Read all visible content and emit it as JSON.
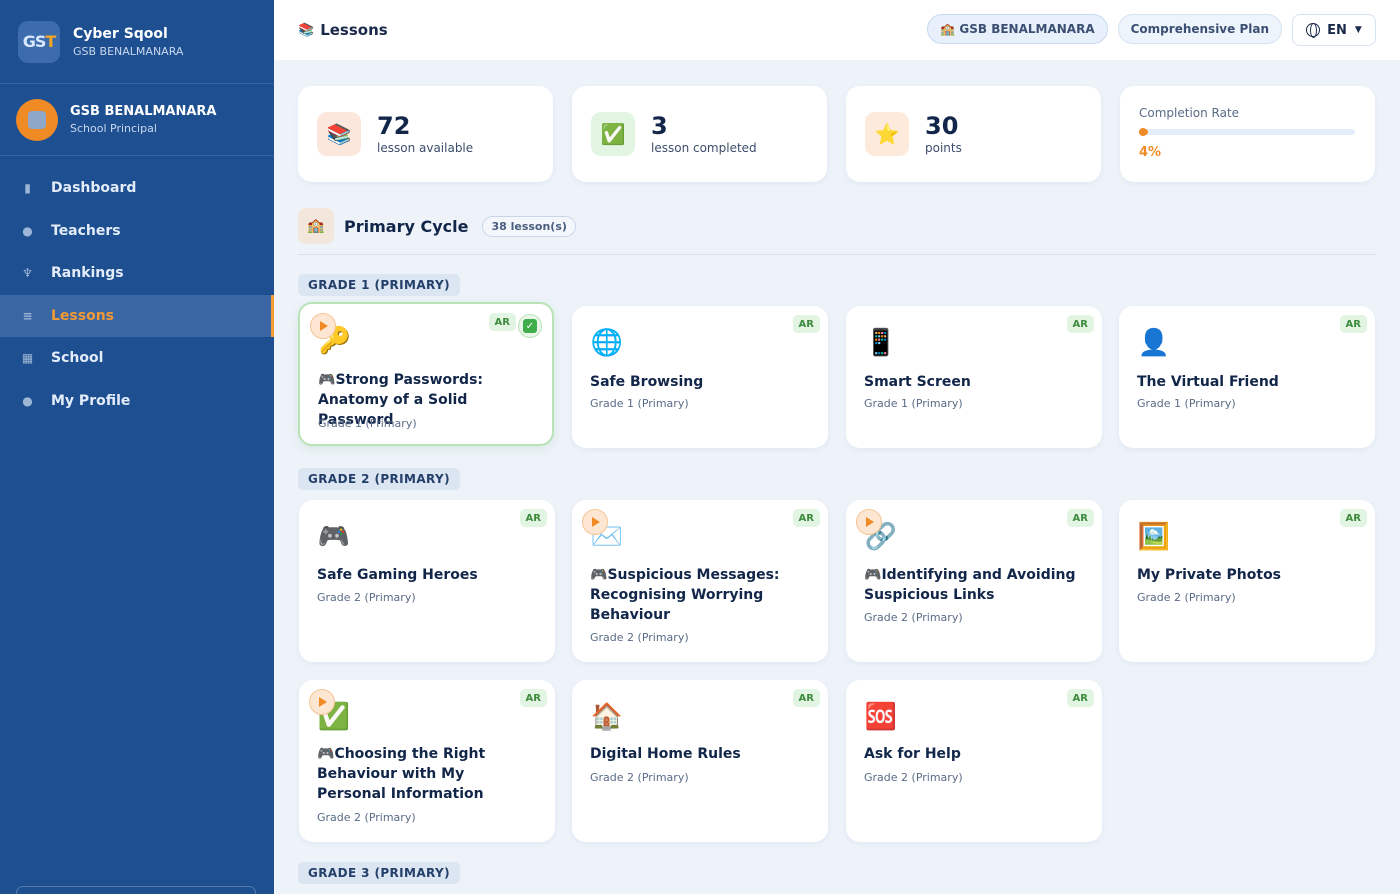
{
  "brand": {
    "logo_text": "GS",
    "logo_accent": "T",
    "title": "Cyber Sqool",
    "subtitle": "GSB BENALMANARA"
  },
  "user": {
    "name": "GSB BENALMANARA",
    "role": "School Principal"
  },
  "nav": [
    {
      "label": "Dashboard",
      "icon": "chart-icon",
      "glyph": "▮"
    },
    {
      "label": "Teachers",
      "icon": "teacher-icon",
      "glyph": "●"
    },
    {
      "label": "Rankings",
      "icon": "trophy-icon",
      "glyph": "♆"
    },
    {
      "label": "Lessons",
      "icon": "books-icon",
      "glyph": "≡",
      "active": true
    },
    {
      "label": "School",
      "icon": "school-icon",
      "glyph": "▦"
    },
    {
      "label": "My Profile",
      "icon": "user-icon",
      "glyph": "●"
    }
  ],
  "header": {
    "title": "Lessons",
    "school_pill": "🏫 GSB BENALMANARA",
    "plan_pill": "Comprehensive Plan",
    "lang": "EN"
  },
  "stats": {
    "available": {
      "value": "72",
      "label": "lesson available",
      "icon": "📚"
    },
    "completed": {
      "value": "3",
      "label": "lesson completed",
      "icon": "✅"
    },
    "points": {
      "value": "30",
      "label": "points",
      "icon": "⭐"
    },
    "completion": {
      "label": "Completion Rate",
      "value": "4%",
      "fraction": 0.04
    }
  },
  "section": {
    "icon": "🏫",
    "title": "Primary Cycle",
    "count": "38 lesson(s)"
  },
  "grades": {
    "g1": "GRADE 1 (PRIMARY)",
    "g2": "GRADE 2 (PRIMARY)",
    "g3": "GRADE 3 (PRIMARY)"
  },
  "badge": "AR",
  "lessons": [
    {
      "emoji": "🔑",
      "game": "🎮",
      "title": "Strong Passwords: Anatomy of a Solid Password",
      "grade": "Grade 1 (Primary)"
    },
    {
      "emoji": "🌐",
      "title": "Safe Browsing",
      "grade": "Grade 1 (Primary)"
    },
    {
      "emoji": "📱",
      "title": "Smart Screen",
      "grade": "Grade 1 (Primary)"
    },
    {
      "emoji": "👤",
      "title": "The Virtual Friend",
      "grade": "Grade 1 (Primary)"
    },
    {
      "emoji": "🎮",
      "title": "Safe Gaming Heroes",
      "grade": "Grade 2 (Primary)"
    },
    {
      "emoji": "✉️",
      "game": "🎮",
      "title": "Suspicious Messages: Recognising Worrying Behaviour",
      "grade": "Grade 2 (Primary)"
    },
    {
      "emoji": "🔗",
      "game": "🎮",
      "title": "Identifying and Avoiding Suspicious Links",
      "grade": "Grade 2 (Primary)"
    },
    {
      "emoji": "🖼️",
      "title": "My Private Photos",
      "grade": "Grade 2 (Primary)"
    },
    {
      "emoji": "✅",
      "game": "🎮",
      "title": "Choosing the Right Behaviour with My Personal Information",
      "grade": "Grade 2 (Primary)"
    },
    {
      "emoji": "🏠",
      "title": "Digital Home Rules",
      "grade": "Grade 2 (Primary)"
    },
    {
      "emoji": "🆘",
      "title": "Ask for Help",
      "grade": "Grade 2 (Primary)"
    }
  ]
}
